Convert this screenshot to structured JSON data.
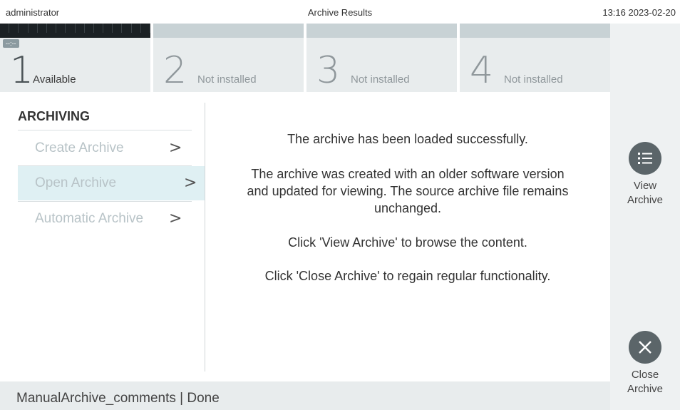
{
  "topbar": {
    "user": "administrator",
    "title": "Archive Results",
    "clock": "13:16 2023-02-20"
  },
  "modules": [
    {
      "number": "1",
      "label": "Available",
      "status": "--:--",
      "active": true
    },
    {
      "number": "2",
      "label": "Not installed",
      "active": false
    },
    {
      "number": "3",
      "label": "Not installed",
      "active": false
    },
    {
      "number": "4",
      "label": "Not installed",
      "active": false
    }
  ],
  "sidebar": {
    "heading": "ARCHIVING",
    "items": [
      {
        "label": "Create Archive",
        "chevron": ">"
      },
      {
        "label": "Open Archive",
        "chevron": ">",
        "selected": true
      },
      {
        "label": "Automatic Archive",
        "chevron": ">"
      }
    ]
  },
  "main": {
    "line1": "The archive has been loaded successfully.",
    "line2a": "The archive was created with an older software version",
    "line2b": "and updated for viewing. The source archive file remains",
    "line2c": "unchanged.",
    "line3": "Click 'View Archive' to browse the content.",
    "line4": "Click 'Close Archive' to regain regular functionality."
  },
  "actions": {
    "view_line1": "View",
    "view_line2": "Archive",
    "close_line1": "Close",
    "close_line2": "Archive"
  },
  "icons": {
    "view": "list-icon",
    "close": "close-x-icon"
  },
  "statusbar": {
    "text": "ManualArchive_comments | Done"
  },
  "colors": {
    "selected_bg": "#dff0f3",
    "action_button": "#5b6569",
    "module_active_bar": "#1b2124"
  }
}
